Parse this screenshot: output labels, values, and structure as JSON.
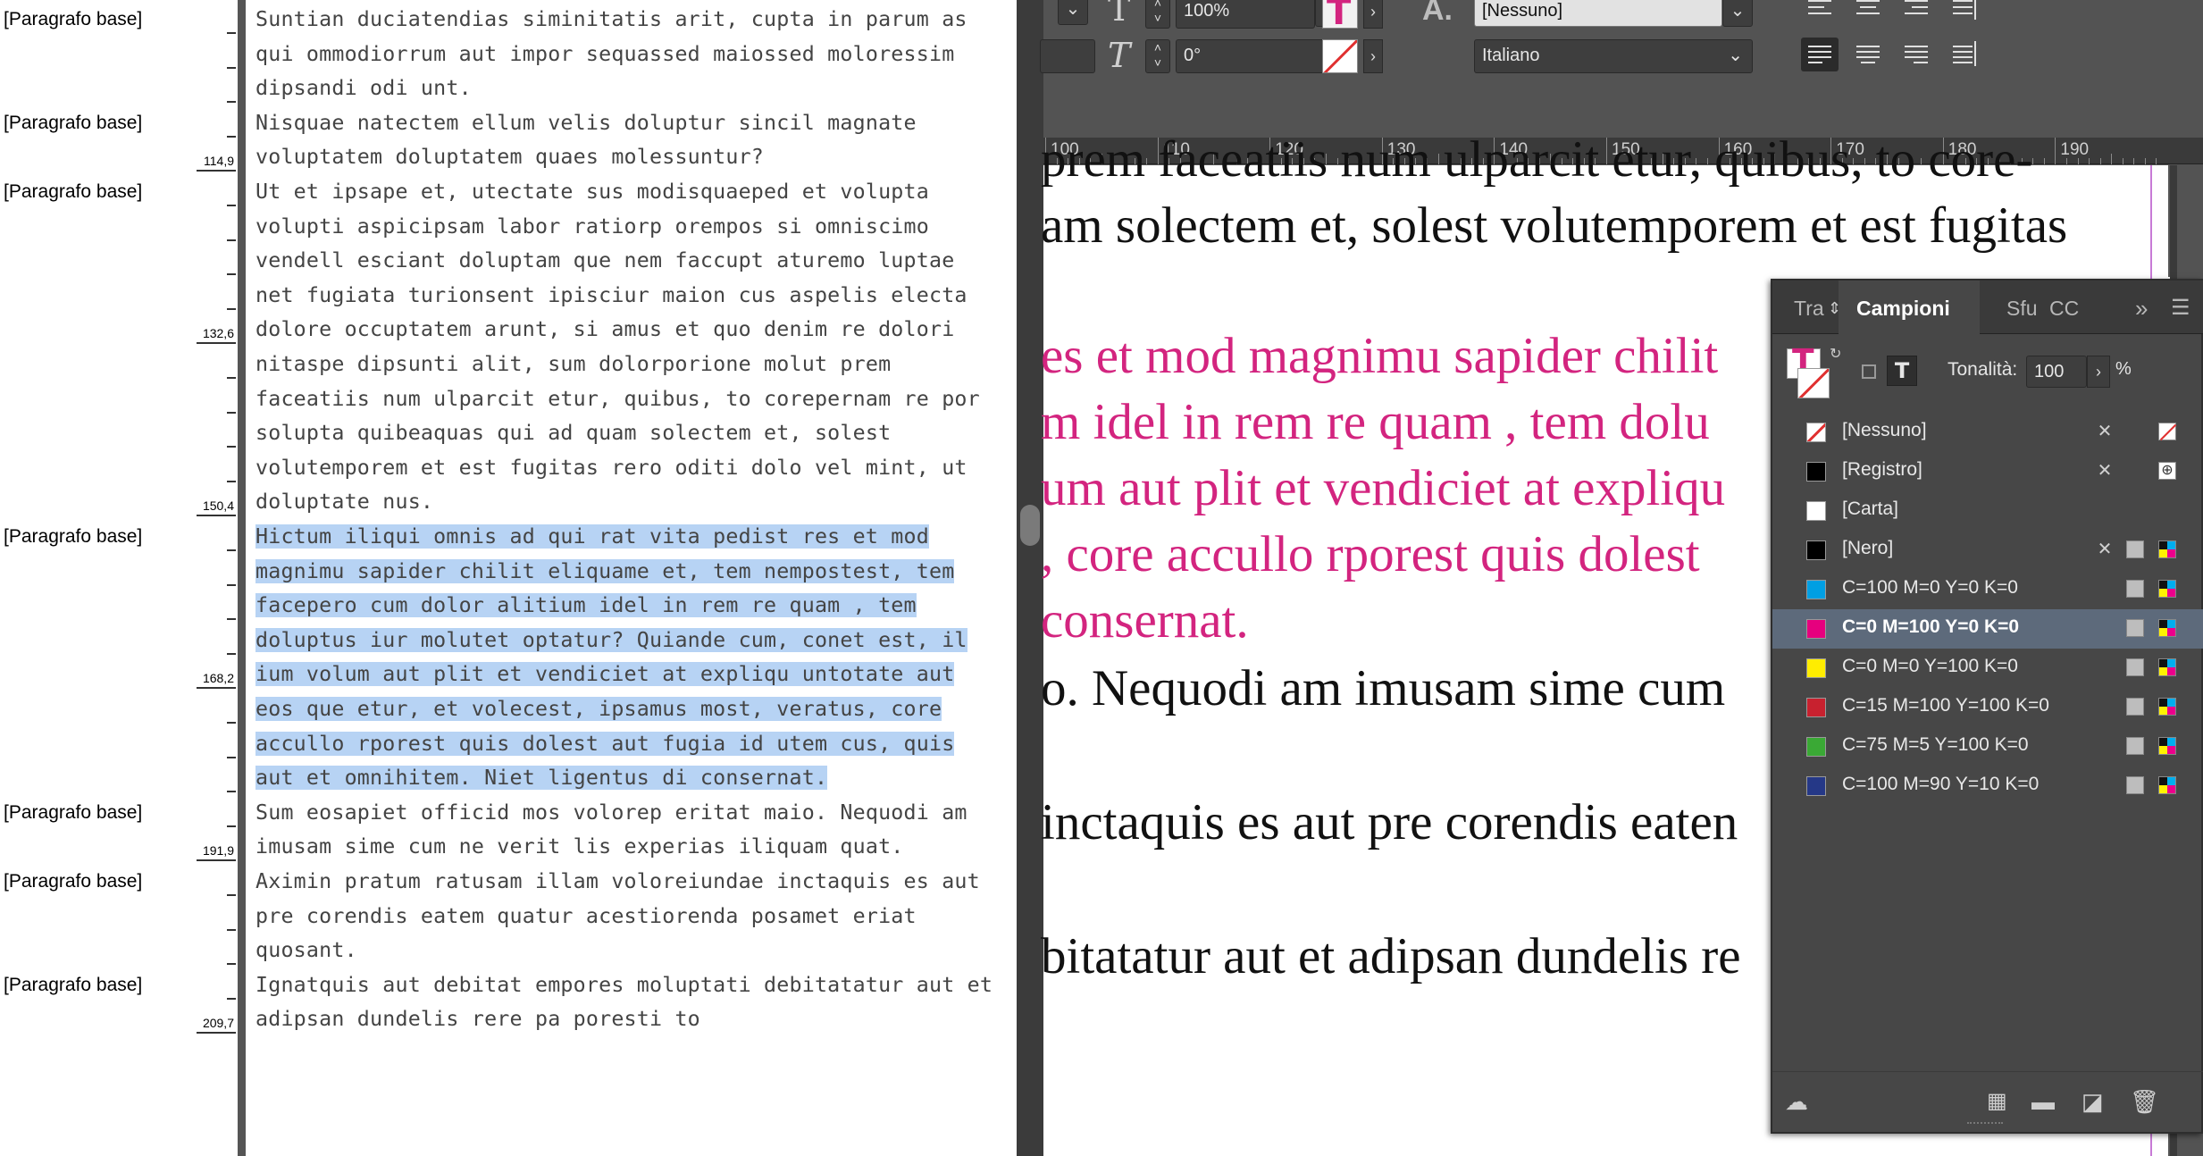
{
  "story": {
    "style_labels": [
      {
        "label": "[Paragrafo base]",
        "line": 0
      },
      {
        "label": "[Paragrafo base]",
        "line": 3
      },
      {
        "label": "[Paragrafo base]",
        "line": 5
      },
      {
        "label": "[Paragrafo base]",
        "line": 15
      },
      {
        "label": "[Paragrafo base]",
        "line": 23
      },
      {
        "label": "[Paragrafo base]",
        "line": 25
      },
      {
        "label": "[Paragrafo base]",
        "line": 28
      }
    ],
    "depth_marks": [
      {
        "line": 4,
        "value": "114,9"
      },
      {
        "line": 9,
        "value": "132,6"
      },
      {
        "line": 14,
        "value": "150,4"
      },
      {
        "line": 19,
        "value": "168,2"
      },
      {
        "line": 24,
        "value": "191,9"
      },
      {
        "line": 29,
        "value": "209,7"
      }
    ],
    "lines": [
      {
        "text": "Suntian duciatendias siminitatis arit, cupta in parum as"
      },
      {
        "text": "qui ommodiorrum aut impor sequassed maiossed moloressim"
      },
      {
        "text": "dipsandi odi unt."
      },
      {
        "text": "Nisquae natectem ellum velis doluptur sincil magnate"
      },
      {
        "text": "voluptatem doluptatem quaes molessuntur?"
      },
      {
        "text": "Ut et ipsape et, utectate sus modisquaeped et volupta"
      },
      {
        "text": "volupti aspicipsam labor ratiorp orempos si omniscimo"
      },
      {
        "text": "vendell esciant doluptam que nem faccupt aturemo luptae"
      },
      {
        "text": "net fugiata turionsent ipisciur maion cus aspelis electa"
      },
      {
        "text": "dolore occuptatem arunt, si amus et quo denim re dolori"
      },
      {
        "text": "nitaspe dipsunti alit, sum dolorporione molut prem"
      },
      {
        "text": "faceatiis num ulparcit etur, quibus, to corepernam re por"
      },
      {
        "text": "solupta quibeaquas qui ad quam solectem et, solest"
      },
      {
        "text": "volutemporem et est fugitas rero oditi dolo vel mint, ut"
      },
      {
        "text": "doluptate nus."
      },
      {
        "text": "Hictum iliqui omnis ad qui rat vita pedist res et mod",
        "selected": true
      },
      {
        "text": "magnimu sapider chilit eliquame et, tem nempostest, tem",
        "selected": true
      },
      {
        "text": "facepero cum dolor alitium idel in rem re quam , tem",
        "selected": true
      },
      {
        "text": "doluptus iur molutet optatur? Quiande cum, conet est, il",
        "selected": true
      },
      {
        "text": "ium volum aut plit et vendiciet at expliqu untotate aut",
        "selected": true
      },
      {
        "text": "eos que etur, et volecest, ipsamus most, veratus, core",
        "selected": true
      },
      {
        "text": "accullo rporest quis dolest aut fugia id utem cus, quis",
        "selected": true
      },
      {
        "text": "aut et omnihitem. Niet ligentus di consernat.",
        "selected": true
      },
      {
        "text": "Sum eosapiet officid mos volorep eritat maio. Nequodi am"
      },
      {
        "text": "imusam sime cum ne verit lis experias iliquam quat."
      },
      {
        "text": "Aximin pratum ratusam illam voloreiundae inctaquis es aut"
      },
      {
        "text": "pre corendis eatem quatur acestiorenda posamet eriat"
      },
      {
        "text": "quosant."
      },
      {
        "text": "Ignatquis aut debitat empores moluptati debitatatur aut et"
      },
      {
        "text": "adipsan dundelis rere pa poresti to"
      }
    ]
  },
  "control_bar": {
    "scale_value": "100%",
    "skew_value": "0°",
    "char_style_value": "[Nessuno]",
    "language_value": "Italiano",
    "char_style_icon": "A."
  },
  "ruler": {
    "ticks": [
      "100",
      "110",
      "120",
      "130",
      "140",
      "150",
      "160",
      "170",
      "180",
      "190"
    ]
  },
  "page_lines": [
    {
      "text": "prem faceatiis num ulparcit etur, quibus, to core-",
      "color": "#111111"
    },
    {
      "text": "am solectem et, solest volutemporem et est fugitas",
      "color": "#111111"
    },
    {
      "text": "es et mod magnimu sapider chilit",
      "color": "#d3247f"
    },
    {
      "text": "m idel in rem re quam , tem dolu",
      "color": "#d3247f"
    },
    {
      "text": "um aut plit et vendiciet at expliqu",
      "color": "#d3247f"
    },
    {
      "text": ", core accullo rporest quis dolest",
      "color": "#d3247f"
    },
    {
      "text": "consernat.",
      "color": "#d3247f"
    },
    {
      "text": "o. Nequodi am imusam sime cum",
      "color": "#111111"
    },
    {
      "text": "inctaquis es aut pre corendis eaten",
      "color": "#111111"
    },
    {
      "text": "bitatatur aut et adipsan dundelis re",
      "color": "#111111"
    }
  ],
  "swatches_panel": {
    "tabs": {
      "tab1": "Tra",
      "active": "Campioni",
      "tab3": "Sfu",
      "tab4": "CC"
    },
    "tint_label": "Tonalità:",
    "tint_value": "100",
    "tint_unit": "%",
    "swatches": [
      {
        "name": "[Nessuno]",
        "color": "none",
        "icons": [
          "pencil",
          "none"
        ]
      },
      {
        "name": "[Registro]",
        "color": "#000000",
        "icons": [
          "pencil",
          "reg"
        ]
      },
      {
        "name": "[Carta]",
        "color": "#ffffff",
        "icons": []
      },
      {
        "name": "[Nero]",
        "color": "#000000",
        "icons": [
          "pencil",
          "grey",
          "cmyk"
        ]
      },
      {
        "name": "C=100 M=0 Y=0 K=0",
        "color": "#009fe3",
        "icons": [
          "grey",
          "cmyk"
        ]
      },
      {
        "name": "C=0 M=100 Y=0 K=0",
        "color": "#e6007e",
        "icons": [
          "grey",
          "cmyk"
        ],
        "selected": true
      },
      {
        "name": "C=0 M=0 Y=100 K=0",
        "color": "#ffed00",
        "icons": [
          "grey",
          "cmyk"
        ]
      },
      {
        "name": "C=15 M=100 Y=100 K=0",
        "color": "#c8212f",
        "icons": [
          "grey",
          "cmyk"
        ]
      },
      {
        "name": "C=75 M=5 Y=100 K=0",
        "color": "#3aa935",
        "icons": [
          "grey",
          "cmyk"
        ]
      },
      {
        "name": "C=100 M=90 Y=10 K=0",
        "color": "#253887",
        "icons": [
          "grey",
          "cmyk"
        ]
      }
    ]
  }
}
